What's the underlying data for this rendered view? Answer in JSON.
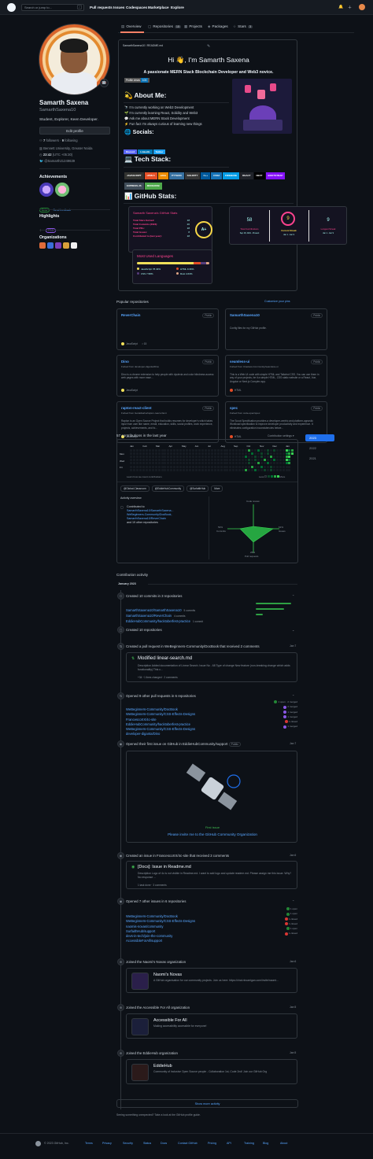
{
  "header": {
    "search_placeholder": "Search or jump to...",
    "slash": "/",
    "nav": [
      "Pull requests",
      "Issues",
      "Codespaces",
      "Marketplace",
      "Explore"
    ]
  },
  "tabs": [
    {
      "label": "Overview",
      "count": ""
    },
    {
      "label": "Repositories",
      "count": "15"
    },
    {
      "label": "Projects",
      "count": ""
    },
    {
      "label": "Packages",
      "count": ""
    },
    {
      "label": "Stars",
      "count": "3"
    }
  ],
  "profile": {
    "name": "Samarth Saxena",
    "login": "SamarthSaxena10",
    "bio": "Student, Explorer, Keen Developer.",
    "edit_label": "Edit profile",
    "followers": "7",
    "followers_label": "followers",
    "following": "9",
    "following_label": "following",
    "location": "Bennett University, Greater Noida",
    "time": "23:42",
    "time_suffix": "(UTC +05:30)",
    "twitter": "@Samarth21249639",
    "status_emoji": "🤖"
  },
  "achievements": {
    "title": "Achievements",
    "beta": "Beta",
    "feedback": "Send feedback"
  },
  "highlights": {
    "title": "Highlights",
    "pro": "PRO"
  },
  "organizations": {
    "title": "Organizations"
  },
  "readme": {
    "path": "SamarthSaxena10 / README.md",
    "title": "Hi 👋, I'm Samarth Saxena",
    "subtitle": "A passionate MERN Stack Blockchain Developer and Web3 novice.",
    "views_label": "Profile views",
    "views": "103",
    "about_title": "💫 About Me:",
    "about": [
      "🔭 I'm currently working on Web3 Development",
      "🌱 I'm currently learning React, Solidity and Web3",
      "💬 Ask me about MERN Stack Development",
      "⚡ Fun fact I'm always curious of learning new things"
    ],
    "socials_title": "🌐 Socials:",
    "socials": [
      "Discord",
      "LinkedIn",
      "Twitter"
    ],
    "tech_title": "💻 Tech Stack:",
    "tech": [
      {
        "label": "JAVASCRIPT",
        "color": "#323330"
      },
      {
        "label": "HTML5",
        "color": "#e34f26"
      },
      {
        "label": "JAVA",
        "color": "#ed8b00"
      },
      {
        "label": "PYTHON",
        "color": "#3670a0"
      },
      {
        "label": "SOLIDITY",
        "color": "#363636"
      },
      {
        "label": "C++",
        "color": "#00599c"
      },
      {
        "label": "CSS3",
        "color": "#1572b6"
      },
      {
        "label": "FIREBASE",
        "color": "#039be5"
      },
      {
        "label": "REACT",
        "color": "#20232a"
      },
      {
        "label": "NEXT",
        "color": "#000000"
      },
      {
        "label": "BOOTSTRAP",
        "color": "#8511fa"
      },
      {
        "label": "EXPRESS.JS",
        "color": "#404d59"
      },
      {
        "label": "MONGODB",
        "color": "#4ea94b"
      }
    ],
    "stats_title": "📊 GitHub Stats:",
    "stats_card": {
      "title": "Samarth Saxena's GitHub Stats",
      "rows": [
        {
          "label": "Total Stars Earned:",
          "value": "18"
        },
        {
          "label": "Total Commits (2023):",
          "value": "20"
        },
        {
          "label": "Total PRs:",
          "value": "18"
        },
        {
          "label": "Total Issues:",
          "value": "8"
        },
        {
          "label": "Contributed to (last year):",
          "value": "18"
        }
      ],
      "grade": "A+"
    },
    "streak_card": {
      "total": "58",
      "total_label": "Total Contributions",
      "total_range": "Sep 18, 2021 - Present",
      "current": "9",
      "current_label": "Current Streak",
      "current_range": "Jan 1 - Jan 9",
      "longest": "9",
      "longest_label": "Longest Streak",
      "longest_range": "Jan 1 - Jan 9"
    },
    "langs_card": {
      "title": "Most Used Languages",
      "items": [
        {
          "name": "JavaScript",
          "pct": "78.43%",
          "color": "#f1e05a"
        },
        {
          "name": "HTML",
          "pct": "9.36%",
          "color": "#e34c26"
        },
        {
          "name": "CSS",
          "pct": "7.58%",
          "color": "#563d7c"
        },
        {
          "name": "Rust",
          "pct": "4.63%",
          "color": "#dea584"
        }
      ]
    }
  },
  "popular": {
    "title": "Popular repositories",
    "customize": "Customize your pins",
    "repos": [
      {
        "name": "ReverChain",
        "visibility": "Public",
        "fork": "",
        "desc": "",
        "lang": "JavaScript",
        "lang_color": "#f1e05a",
        "stars": "15"
      },
      {
        "name": "SamarthSaxena10",
        "visibility": "Public",
        "fork": "",
        "desc": "Config files for my GitHub profile.",
        "lang": "",
        "lang_color": "",
        "stars": ""
      },
      {
        "name": "Dino",
        "visibility": "Public",
        "fork": "Forked from developer-diganta/Dino",
        "desc": "Dino is a chrome extension to help people with dyslexia and color blindness access web pages with more ease...",
        "lang": "JavaScript",
        "lang_color": "#f1e05a",
        "stars": ""
      },
      {
        "name": "seamless-ui",
        "visibility": "Public",
        "fork": "Forked from Clueless-Community/seamless-ui",
        "desc": "This is a Web UI code with simple HTML and Tailwind CSS. You can use them in any of your projects, be it a simple HTML, CSS static website or a React, Vue, Angular or Next.js Complex app.",
        "lang": "HTML",
        "lang_color": "#e34c26",
        "stars": ""
      },
      {
        "name": "rapton-react-client",
        "visibility": "Public",
        "fork": "Forked from Geraldsahu/rapton-react-client",
        "desc": "Rapton is an Open Source Project that builds resumes for developer's which takes input from user like name, email, education, skills, social profiles, work experience, projects, achievements, and fo...",
        "lang": "JavaScript",
        "lang_color": "#f1e05a",
        "stars": ""
      },
      {
        "name": "spec",
        "visibility": "Public",
        "fork": "Forked from code-open/spec",
        "desc": "The Scout Specification provides a developer-centric and platform-agnostic Workload specification to improve developer productivity and experience. It eliminates configuration inconsistencies betwe...",
        "lang": "HTML",
        "lang_color": "#e34c26",
        "stars": ""
      }
    ]
  },
  "contributions": {
    "title": "57 contributions in the last year",
    "settings": "Contribution settings ▾",
    "months": [
      "Jan",
      "Feb",
      "Mar",
      "Apr",
      "May",
      "Jun",
      "Jul",
      "Aug",
      "Sep",
      "Oct",
      "Nov",
      "Dec",
      "Jan"
    ],
    "days": [
      "Mon",
      "Wed",
      "Fri"
    ],
    "learn": "Learn how we count contributions",
    "less": "Less",
    "more": "More",
    "orgs": [
      "@Global-Classroom",
      "@EddieHubCommunity",
      "@SurfaithHub",
      "More"
    ],
    "overview_title": "Activity overview",
    "contributed_label": "Contributed to",
    "contributed_repos": [
      "SamarthSaxena10/SamarthSaxena...",
      "WeBeginners-Community/DocBook,",
      "SamarthSaxena10/ReverChain"
    ],
    "other": "and 19 other repositories",
    "radar": {
      "code_review": "Code review",
      "commits": "Commits",
      "commits_pct": "53%",
      "issues": "Issues",
      "issues_pct": "61%",
      "prs": "Pull requests",
      "prs_pct": "26%"
    },
    "years": [
      "2023",
      "2022",
      "2021"
    ]
  },
  "activity": {
    "title": "Contribution activity",
    "month": "January 2023",
    "commits_title": "Created 10 commits in 3 repositories",
    "commits": [
      {
        "repo": "SamarthSaxena10/SamarthSaxena10",
        "count": "5 commits"
      },
      {
        "repo": "SamarthSaxena10/ReverChain",
        "count": "4 commits"
      },
      {
        "repo": "EddieHubCommunity/hacktoberfest-practice",
        "count": "1 commit"
      }
    ],
    "created_title": "Created 10 repositories",
    "pr_title": "Created a pull request in WeBeginners-Community/DocBook that received 2 comments",
    "pr_date": "Jan 7",
    "pr_name": "Modified linear-search.md",
    "pr_desc": "Description Added documentation of Linear Search. Issue No - 68 Type of change New feature (non-breaking change which adds functionality) This c...",
    "pr_stat": "+34 −1 lines changed · 2 comments",
    "opened_title": "Opened 9 other pull requests in 6 repositories",
    "opened_prs": [
      {
        "repo": "WeBeginners-Community/DocBook",
        "state": "open",
        "counts": "1 open · 2 merged"
      },
      {
        "repo": "WeBeginners-Community/CSS-Effects-Designs",
        "state": "merged",
        "counts": "2 merged"
      },
      {
        "repo": "FrancescoXX/4c-site",
        "state": "merged",
        "counts": "1 merged"
      },
      {
        "repo": "EddieHubCommunity/hacktoberfest-practice",
        "state": "merged",
        "counts": "1 merged"
      },
      {
        "repo": "WeBeginners-Community/CSS-Effects-Designs",
        "state": "closed",
        "counts": "1 closed"
      },
      {
        "repo": "developer-diganta/Dino",
        "state": "merged",
        "counts": "1 merged"
      }
    ],
    "first_issue_title": "Opened their first issue on GitHub in EddieHubCommunity/support",
    "first_issue_public": "Public",
    "first_issue_date": "Jan 7",
    "first_issue_label": "First issue",
    "first_issue_link": "Please invite me to the GitHub Community Organization",
    "issue_title": "Created an issue in FrancescoXX/4c-site that received 3 comments",
    "issue_date": "Jan 6",
    "issue_name": "[Docs]: Issue in Readme.md",
    "issue_desc": "Description Logo of 4c is not visible in Readme.md. I want to add logo and update readme.md. Please assign me this issue. Why? No response ...",
    "issue_stat": "1 task done · 3 comments",
    "other_issues_title": "Opened 7 other issues in 6 repositories",
    "other_issues": [
      {
        "repo": "WeBeginners-Community/DocBook",
        "state": "open",
        "counts": "1 open"
      },
      {
        "repo": "WeBeginners-Community/CSS-Effects-Designs",
        "state": "open",
        "counts": "1 open"
      },
      {
        "repo": "naomis-novas/community",
        "state": "closed",
        "counts": "1 closed"
      },
      {
        "repo": "SurfaithHub/support",
        "state": "closed",
        "counts": "1 closed"
      },
      {
        "repo": "devs-in-tech/join-the-community",
        "state": "open",
        "counts": "1 open"
      },
      {
        "repo": "AccessibleForAll/support",
        "state": "closed",
        "counts": "1 closed"
      }
    ],
    "joined": [
      {
        "title": "Joined the Naomi's Novas organization",
        "date": "Jan 6",
        "org": "Naomi's Novas",
        "desc": "A GitHub organisation for our community projects. Join us here: https://chat.nhcarrigan.com/invite/naomi...",
        "color": "#2a1f4a"
      },
      {
        "title": "Joined the Accessible For All organization",
        "date": "Jan 5",
        "org": "Accessible For All",
        "desc": "Making accessibility accessible for everyone!",
        "color": "#1b1f3a"
      },
      {
        "title": "Joined the EddieHub organization",
        "date": "Jan 5",
        "org": "EddieHub",
        "desc": "Community of Inclusive Open Source people - Collaboration 1st, Code 2nd! Join our GitHub Org",
        "color": "#2b1a1a"
      }
    ],
    "show_more": "Show more activity",
    "tip": "Seeing something unexpected? Take a look at the GitHub profile guide."
  },
  "footer": {
    "copy": "© 2023 GitHub, Inc.",
    "links": [
      "Terms",
      "Privacy",
      "Security",
      "Status",
      "Docs",
      "Contact GitHub",
      "Pricing",
      "API",
      "Training",
      "Blog",
      "About"
    ]
  }
}
